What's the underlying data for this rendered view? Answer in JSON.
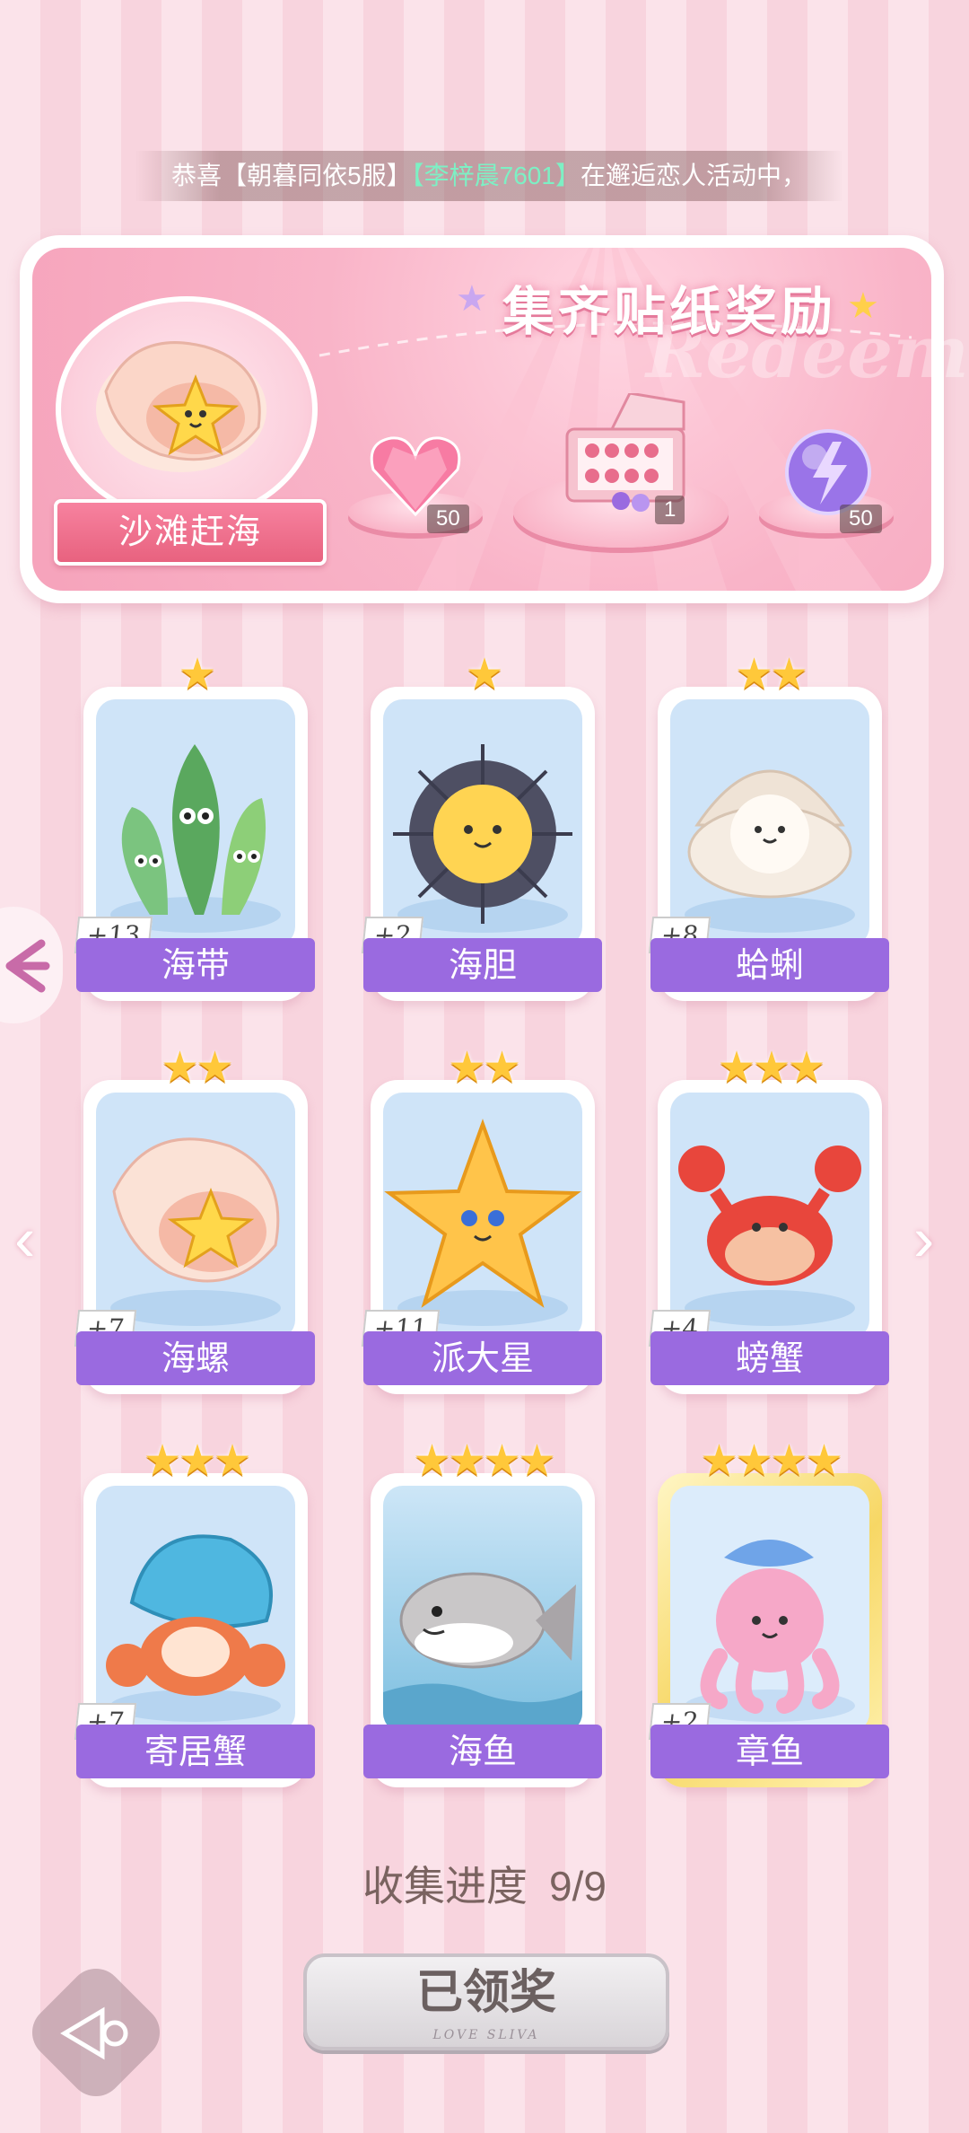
{
  "marquee": {
    "prefix": "恭喜",
    "server": "【朝暮同依5服】",
    "player": "【李梓晨7601】",
    "suffix": "在邂逅恋人活动中，"
  },
  "banner": {
    "title": "集齐贴纸奖励",
    "watermark": "Redeem",
    "set_name": "沙滩赶海",
    "rewards": [
      {
        "name": "heart-gem",
        "count": "50"
      },
      {
        "name": "gift-box",
        "count": "1"
      },
      {
        "name": "energy-orb",
        "count": "50"
      }
    ]
  },
  "cards": [
    {
      "name": "海带",
      "count": "+13",
      "stars": "★"
    },
    {
      "name": "海胆",
      "count": "+2",
      "stars": "★"
    },
    {
      "name": "蛤蜊",
      "count": "+8",
      "stars": "★★"
    },
    {
      "name": "海螺",
      "count": "+7",
      "stars": "★★"
    },
    {
      "name": "派大星",
      "count": "+11",
      "stars": "★★"
    },
    {
      "name": "螃蟹",
      "count": "+4",
      "stars": "★★★"
    },
    {
      "name": "寄居蟹",
      "count": "+7",
      "stars": "★★★"
    },
    {
      "name": "海鱼",
      "count": "",
      "stars": "★★★★"
    },
    {
      "name": "章鱼",
      "count": "+2",
      "stars": "★★★★"
    }
  ],
  "progress": {
    "label": "收集进度",
    "value": "9/9"
  },
  "claim": {
    "label": "已领奖",
    "sub": "LOVE SLIVA"
  }
}
